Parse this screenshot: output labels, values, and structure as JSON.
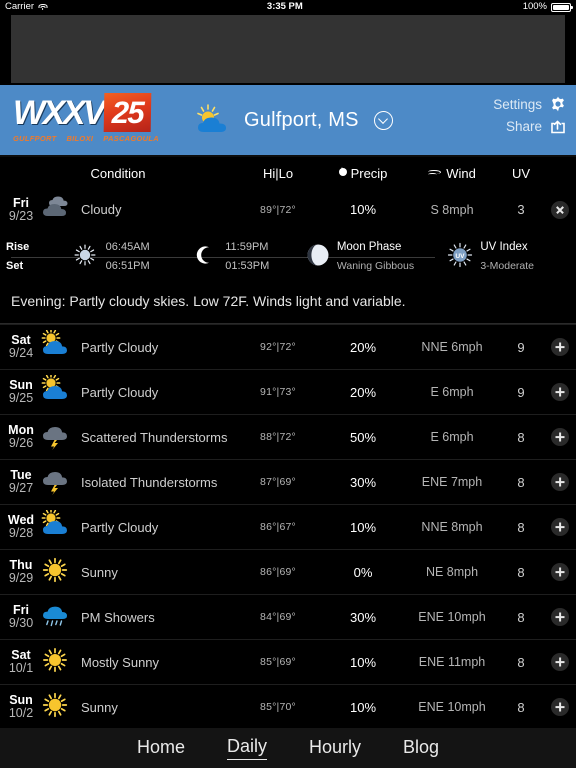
{
  "status_bar": {
    "carrier": "Carrier",
    "wifi_icon": "wifi-icon",
    "time": "3:35 PM",
    "battery_pct": "100%",
    "battery_icon": "battery-icon"
  },
  "ad_banner": {
    "name": "ad-banner-slot",
    "label": ""
  },
  "header": {
    "logo": {
      "call_sign": "WXXV",
      "channel": "25",
      "city1": "GULFPORT",
      "city2": "BILOXI",
      "city3": "PASCAGOULA"
    },
    "location_icon": "partly-cloudy-icon",
    "location": "Gulfport, MS",
    "location_chevron_icon": "chevron-down-circle-icon",
    "settings_label": "Settings",
    "settings_icon": "gear-icon",
    "share_label": "Share",
    "share_icon": "share-icon",
    "bg_color": "#4d8ac7"
  },
  "columns": {
    "condition": "Condition",
    "hilo": "Hi|Lo",
    "precip": "Precip",
    "precip_icon": "water-drop-icon",
    "wind": "Wind",
    "wind_icon": "wind-icon",
    "uv": "UV"
  },
  "expanded_detail": {
    "rise_label": "Rise",
    "set_label": "Set",
    "sun_icon": "sun-icon",
    "sun_rise": "06:45AM",
    "sun_set": "06:51PM",
    "moon_icon": "crescent-moon-icon",
    "moon_rise": "11:59PM",
    "moon_set": "01:53PM",
    "moon_phase_icon": "moon-phase-icon",
    "moon_phase_label": "Moon Phase",
    "moon_phase_value": "Waning Gibbous",
    "uv_icon": "uv-sun-icon",
    "uv_label": "UV Index",
    "uv_value": "3-Moderate",
    "forecast_text": "Evening: Partly cloudy skies. Low 72F. Winds light and variable."
  },
  "days": [
    {
      "dow": "Fri",
      "date": "9/23",
      "icon": "cloudy-icon",
      "condition": "Cloudy",
      "hilo": "89°|72°",
      "precip": "10%",
      "wind": "S 8mph",
      "uv": "3",
      "button": "close-button",
      "expanded": true
    },
    {
      "dow": "Sat",
      "date": "9/24",
      "icon": "partly-cloudy-icon",
      "condition": "Partly Cloudy",
      "hilo": "92°|72°",
      "precip": "20%",
      "wind": "NNE 6mph",
      "uv": "9",
      "button": "expand-button",
      "expanded": false
    },
    {
      "dow": "Sun",
      "date": "9/25",
      "icon": "partly-cloudy-icon",
      "condition": "Partly Cloudy",
      "hilo": "91°|73°",
      "precip": "20%",
      "wind": "E 6mph",
      "uv": "9",
      "button": "expand-button",
      "expanded": false
    },
    {
      "dow": "Mon",
      "date": "9/26",
      "icon": "thunderstorm-icon",
      "condition": "Scattered Thunderstorms",
      "hilo": "88°|72°",
      "precip": "50%",
      "wind": "E 6mph",
      "uv": "8",
      "button": "expand-button",
      "expanded": false
    },
    {
      "dow": "Tue",
      "date": "9/27",
      "icon": "thunderstorm-icon",
      "condition": "Isolated Thunderstorms",
      "hilo": "87°|69°",
      "precip": "30%",
      "wind": "ENE 7mph",
      "uv": "8",
      "button": "expand-button",
      "expanded": false
    },
    {
      "dow": "Wed",
      "date": "9/28",
      "icon": "partly-cloudy-icon",
      "condition": "Partly Cloudy",
      "hilo": "86°|67°",
      "precip": "10%",
      "wind": "NNE 8mph",
      "uv": "8",
      "button": "expand-button",
      "expanded": false
    },
    {
      "dow": "Thu",
      "date": "9/29",
      "icon": "sunny-icon",
      "condition": "Sunny",
      "hilo": "86°|69°",
      "precip": "0%",
      "wind": "NE 8mph",
      "uv": "8",
      "button": "expand-button",
      "expanded": false
    },
    {
      "dow": "Fri",
      "date": "9/30",
      "icon": "rain-showers-icon",
      "condition": "PM Showers",
      "hilo": "84°|69°",
      "precip": "30%",
      "wind": "ENE 10mph",
      "uv": "8",
      "button": "expand-button",
      "expanded": false
    },
    {
      "dow": "Sat",
      "date": "10/1",
      "icon": "mostly-sunny-icon",
      "condition": "Mostly Sunny",
      "hilo": "85°|69°",
      "precip": "10%",
      "wind": "ENE 11mph",
      "uv": "8",
      "button": "expand-button",
      "expanded": false
    },
    {
      "dow": "Sun",
      "date": "10/2",
      "icon": "sunny-icon",
      "condition": "Sunny",
      "hilo": "85°|70°",
      "precip": "10%",
      "wind": "ENE 10mph",
      "uv": "8",
      "button": "expand-button",
      "expanded": false
    }
  ],
  "tabs": [
    {
      "label": "Home",
      "active": false
    },
    {
      "label": "Daily",
      "active": true
    },
    {
      "label": "Hourly",
      "active": false
    },
    {
      "label": "Blog",
      "active": false
    }
  ]
}
